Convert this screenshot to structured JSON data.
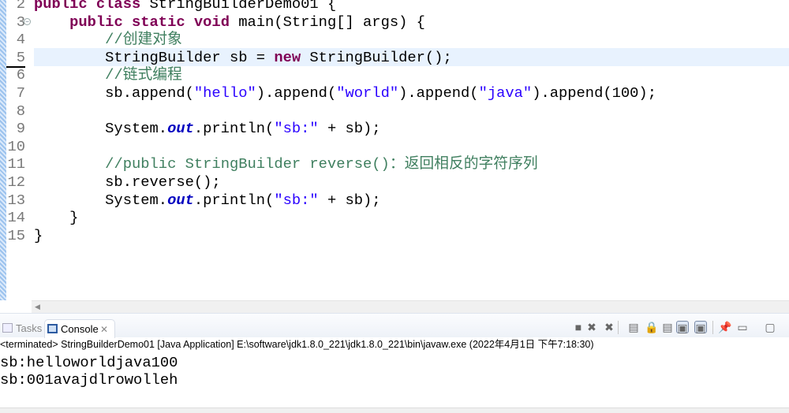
{
  "editor": {
    "line_numbers": [
      "2",
      "3",
      "4",
      "5",
      "6",
      "7",
      "8",
      "9",
      "10",
      "11",
      "12",
      "13",
      "14",
      "15"
    ],
    "lines": [
      [
        {
          "t": "kw",
          "v": "public class "
        },
        {
          "t": "",
          "v": "StringBuilderDemo01 {"
        }
      ],
      [
        {
          "t": "",
          "v": "    "
        },
        {
          "t": "kw",
          "v": "public static void "
        },
        {
          "t": "",
          "v": "main(String[] args) {"
        }
      ],
      [
        {
          "t": "",
          "v": "        "
        },
        {
          "t": "cm",
          "v": "//创建对象"
        }
      ],
      [
        {
          "t": "",
          "v": "        StringBuilder sb = "
        },
        {
          "t": "kw",
          "v": "new"
        },
        {
          "t": "",
          "v": " StringBuilder();"
        }
      ],
      [
        {
          "t": "",
          "v": "        "
        },
        {
          "t": "cm",
          "v": "//链式编程"
        }
      ],
      [
        {
          "t": "",
          "v": "        sb.append("
        },
        {
          "t": "str",
          "v": "\"hello\""
        },
        {
          "t": "",
          "v": ").append("
        },
        {
          "t": "str",
          "v": "\"world\""
        },
        {
          "t": "",
          "v": ").append("
        },
        {
          "t": "str",
          "v": "\"java\""
        },
        {
          "t": "",
          "v": ").append(100);"
        }
      ],
      [],
      [
        {
          "t": "",
          "v": "        System."
        },
        {
          "t": "fld",
          "v": "out"
        },
        {
          "t": "",
          "v": ".println("
        },
        {
          "t": "str",
          "v": "\"sb:\""
        },
        {
          "t": "",
          "v": " + sb);"
        }
      ],
      [],
      [
        {
          "t": "",
          "v": "        "
        },
        {
          "t": "cm",
          "v": "//public StringBuilder reverse()：返回相反的字符序列"
        }
      ],
      [
        {
          "t": "",
          "v": "        sb.reverse();"
        }
      ],
      [
        {
          "t": "",
          "v": "        System."
        },
        {
          "t": "fld",
          "v": "out"
        },
        {
          "t": "",
          "v": ".println("
        },
        {
          "t": "str",
          "v": "\"sb:\""
        },
        {
          "t": "",
          "v": " + sb);"
        }
      ],
      [
        {
          "t": "",
          "v": "    }"
        }
      ],
      [
        {
          "t": "",
          "v": "}"
        }
      ]
    ],
    "current_line": "5"
  },
  "console": {
    "tabs": [
      {
        "label": "Tasks",
        "icon": "tasks-icon"
      },
      {
        "label": "Console",
        "icon": "console-icon",
        "active": true
      }
    ],
    "status": "<terminated> StringBuilderDemo01 [Java Application] E:\\software\\jdk1.8.0_221\\jdk1.8.0_221\\bin\\javaw.exe (2022年4月1日 下午7:18:30)",
    "output": [
      "sb:helloworldjava100",
      "sb:001avajdlrowolleh"
    ],
    "toolbar": [
      "terminate-icon",
      "remove-launch-icon",
      "remove-all-terminated-icon",
      "clear-console-icon",
      "scroll-lock-icon",
      "word-wrap-icon",
      "show-on-stdout-icon",
      "show-on-stderr-icon",
      "pin-console-icon",
      "display-console-icon",
      "open-console-icon"
    ]
  },
  "colors": {
    "keyword": "#7f0055",
    "string": "#2a00ff",
    "comment": "#3f7f5f",
    "field": "#0000c0",
    "current_line": "#e8f2fe"
  }
}
